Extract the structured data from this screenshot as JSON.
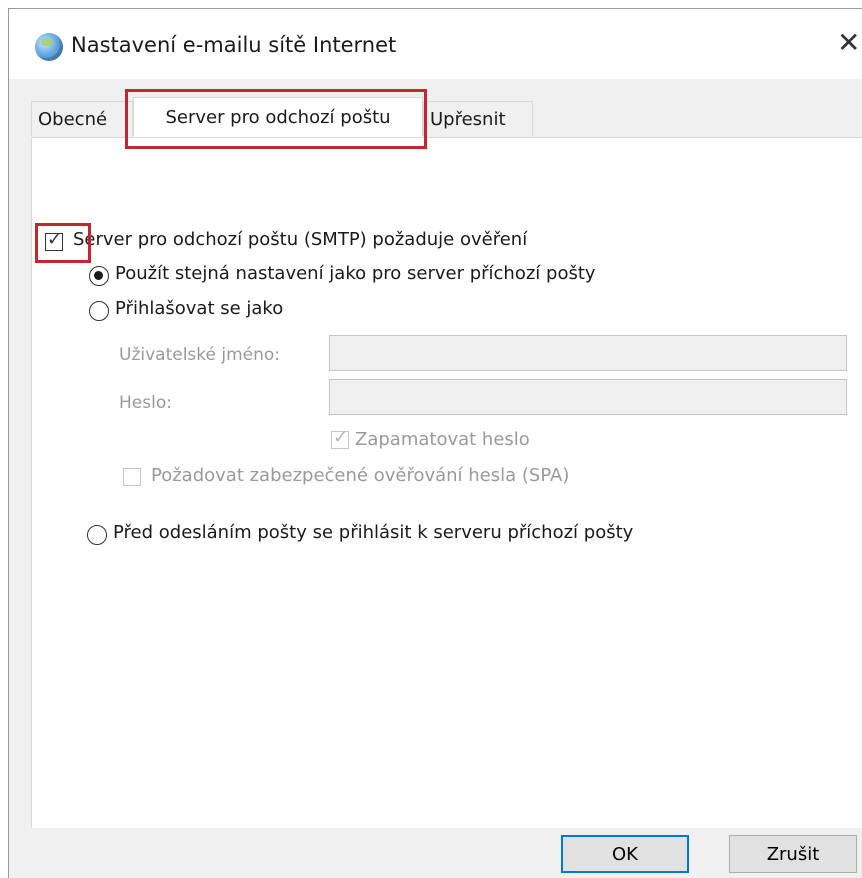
{
  "window": {
    "title": "Nastavení e-mailu sítě Internet",
    "close_glyph": "✕"
  },
  "tabs": {
    "general": "Obecné",
    "outgoing": "Server pro odchozí poštu",
    "advanced": "Upřesnit",
    "active": "outgoing"
  },
  "outgoing": {
    "smtp_auth": {
      "label": "Server pro odchozí poštu (SMTP) požaduje ověření",
      "checked": true
    },
    "same_as_incoming": {
      "label": "Použít stejná nastavení jako pro server příchozí pošty",
      "selected": true
    },
    "log_on_using": {
      "label": "Přihlašovat se jako",
      "selected": false
    },
    "username": {
      "label": "Uživatelské jméno:",
      "value": ""
    },
    "password": {
      "label": "Heslo:",
      "value": ""
    },
    "remember_password": {
      "label": "Zapamatovat heslo",
      "checked": true,
      "enabled": false
    },
    "require_spa": {
      "label": "Požadovat zabezpečené ověřování hesla (SPA)",
      "checked": false,
      "enabled": false
    },
    "log_on_before": {
      "label": "Před odesláním pošty se přihlásit k serveru příchozí pošty",
      "selected": false
    }
  },
  "buttons": {
    "ok": "OK",
    "cancel": "Zrušit"
  },
  "colors": {
    "highlight": "#c1272d",
    "primary_button_border": "#0078d7",
    "dialog_background": "#f0f0f0"
  }
}
